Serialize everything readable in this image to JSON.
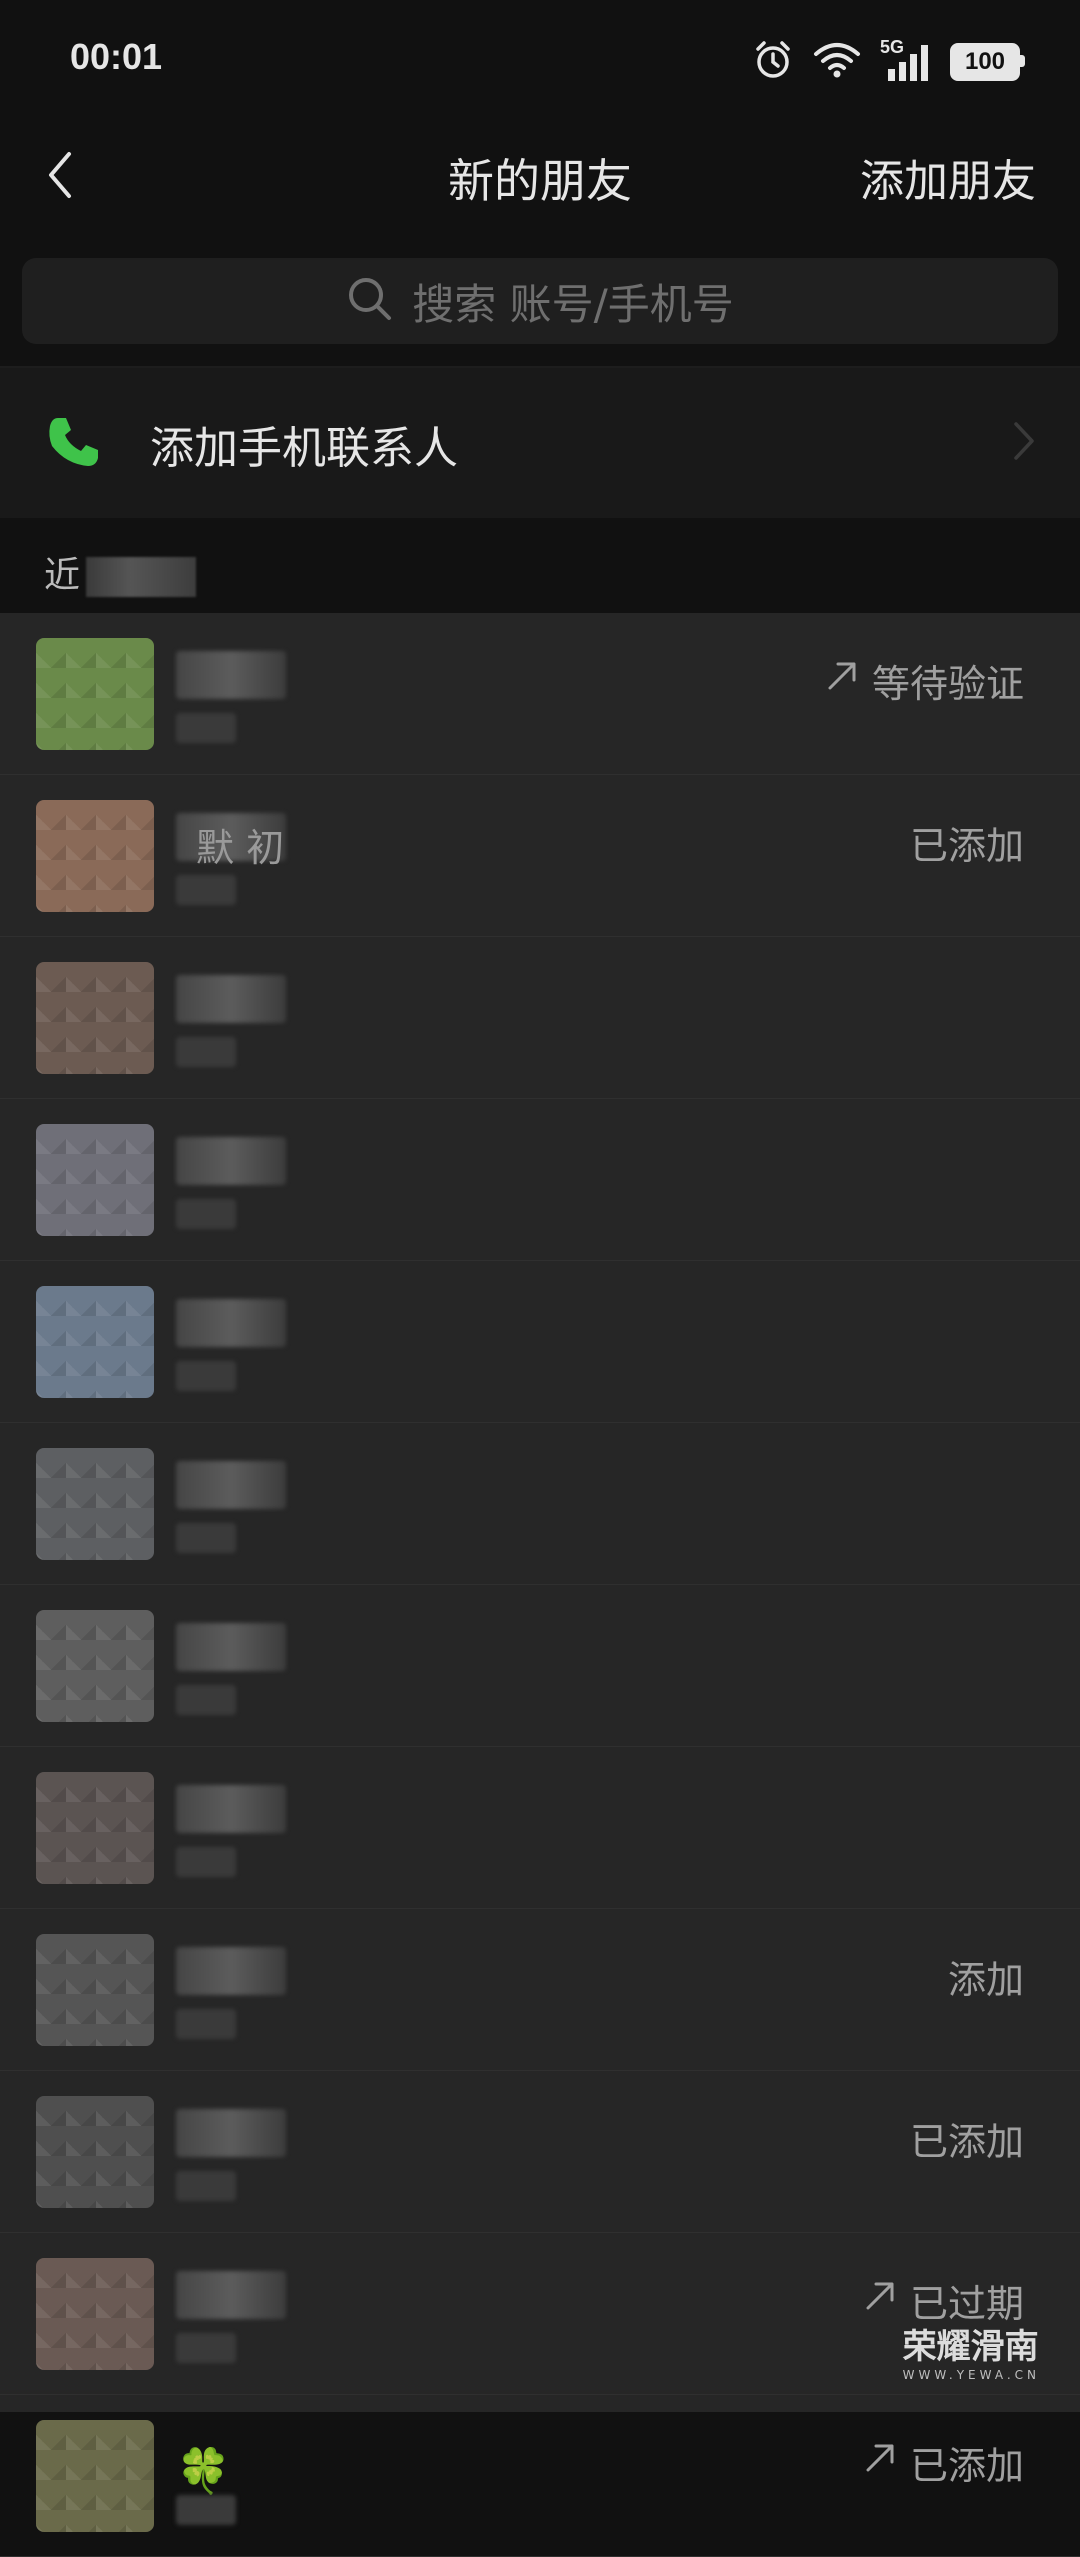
{
  "status_bar": {
    "time": "00:01",
    "signal_label": "5G",
    "battery": "100"
  },
  "nav": {
    "title": "新的朋友",
    "action": "添加朋友"
  },
  "search": {
    "placeholder": "搜索 账号/手机号"
  },
  "add_contacts": {
    "label": "添加手机联系人",
    "icon_color": "#3fc34a"
  },
  "section": {
    "label": "近"
  },
  "list": [
    {
      "name": "",
      "status": "等待验证",
      "status_icon": "arrow-up-right-icon",
      "avatar_color": "#6a8a4a"
    },
    {
      "name": "默 初",
      "status": "已添加",
      "status_icon": "",
      "avatar_color": "#8a6a58"
    },
    {
      "name": "",
      "status": "",
      "status_icon": "",
      "avatar_color": "#6c5b52"
    },
    {
      "name": "",
      "status": "",
      "status_icon": "",
      "avatar_color": "#6f6f78"
    },
    {
      "name": "",
      "status": "",
      "status_icon": "",
      "avatar_color": "#6b7a8c"
    },
    {
      "name": "",
      "status": "",
      "status_icon": "",
      "avatar_color": "#5d5f62"
    },
    {
      "name": "",
      "status": "",
      "status_icon": "",
      "avatar_color": "#5e5e5e"
    },
    {
      "name": "",
      "status": "",
      "status_icon": "",
      "avatar_color": "#5b5452"
    },
    {
      "name": "",
      "status": "添加",
      "status_icon": "",
      "avatar_color": "#555555"
    },
    {
      "name": "",
      "status": "已添加",
      "status_icon": "",
      "avatar_color": "#4f4f4f"
    },
    {
      "name": "",
      "status": "已过期",
      "status_icon": "arrow-up-right-icon",
      "avatar_color": "#6a5a54"
    },
    {
      "name": "",
      "status": "已添加",
      "status_icon": "arrow-up-right-icon",
      "avatar_color": "#6a6a4a",
      "emoji": "🍀"
    }
  ],
  "watermark": {
    "text": "荣耀滑南",
    "sub": "WWW.YEWA.CN"
  },
  "colors": {
    "background": "#111111",
    "list_background": "#262626",
    "accent_green": "#3fc34a"
  }
}
